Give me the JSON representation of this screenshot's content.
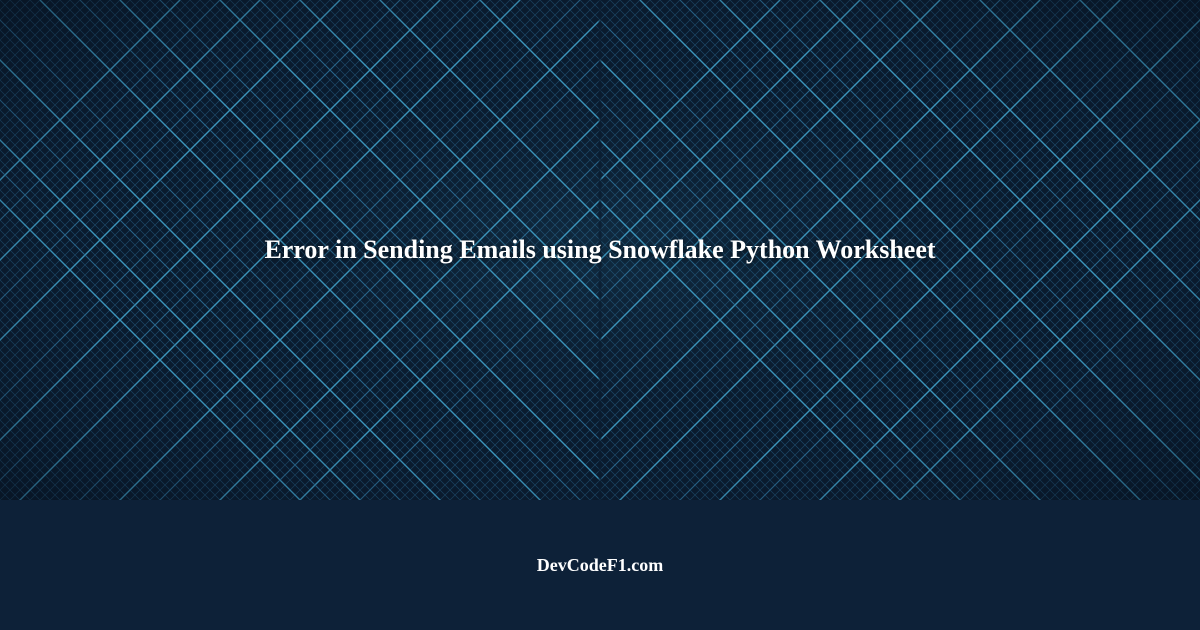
{
  "hero": {
    "title": "Error in Sending Emails using Snowflake Python Worksheet"
  },
  "footer": {
    "site_name": "DevCodeF1.com"
  },
  "colors": {
    "bg_dark": "#0a1b2e",
    "footer_bg": "#0d2138",
    "line_light": "#3fa0c8",
    "line_mid": "#2a6d94",
    "line_dim": "#1c4766",
    "text": "#ffffff"
  }
}
